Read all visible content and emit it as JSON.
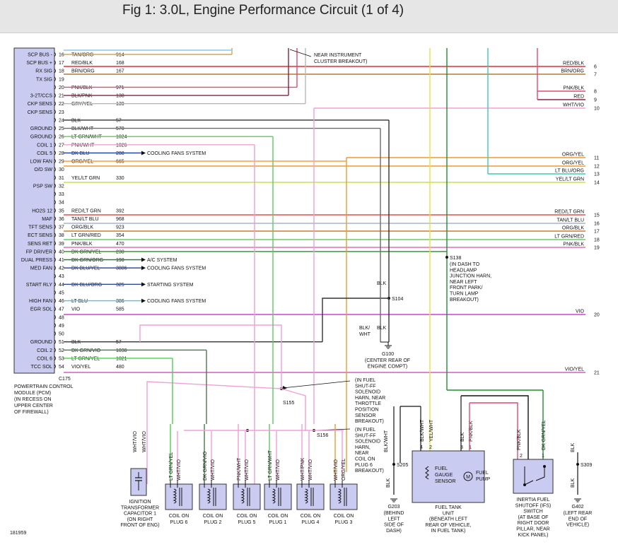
{
  "title": "Fig 1: 3.0L, Engine Performance Circuit (1 of 4)",
  "colors": {
    "pin": "#1a1a1a",
    "box_fill": "#c9cbf0",
    "box_stroke": "#333333",
    "tan_org": "#d2a65a",
    "red_blk": "#e0303a",
    "brn_org": "#b07a3a",
    "pnk_blk": "#e04a74",
    "blk_pnk": "#8a2240",
    "gry_yel": "#b8b8b0",
    "blk": "#333333",
    "blk_wht": "#6a6a6a",
    "lt_grn_wht": "#5ecb5e",
    "pnk_wht": "#f0a0c8",
    "dk_blu": "#1f3f9f",
    "org_yel": "#f09a30",
    "yel_lt_grn": "#c8e050",
    "red_lt_grn": "#e05050",
    "tan_lt_blu": "#a2b8c8",
    "org_blk": "#d07a30",
    "lt_grn_red": "#6acb6a",
    "pnk_blu": "#e070b0",
    "dk_grn_yel": "#3a9a3a",
    "dk_grn_org": "#2e7d32",
    "dk_blu_yel": "#3050a8",
    "dk_blu_org": "#304a9a",
    "lt_blu": "#50c0e0",
    "vio": "#d040d0",
    "dk_grn_vio": "#4a7a4a",
    "vio_yel": "#d060c0",
    "lt_blu_org": "#40c8b8",
    "wht_vio": "#f0a0d8",
    "yel_wht": "#e8e040",
    "lt_grn": "#50d050",
    "dk_grn": "#1f8f2f",
    "tan_lt_blu_short": "#8ac8e8"
  },
  "pcm": {
    "connector": "C175",
    "label": [
      "POWERTRAIN CONTROL",
      "MODULE (PCM)",
      "(IN RECESS ON",
      "UPPER CENTER",
      "OF FIREWALL)"
    ],
    "pins": [
      {
        "name": "SCP BUS -",
        "pin": "16",
        "wire": "TAN/ORG",
        "circuit": "914"
      },
      {
        "name": "SCP BUS +",
        "pin": "17",
        "wire": "RED/BLK",
        "circuit": "168"
      },
      {
        "name": "RX SIG",
        "pin": "18",
        "wire": "BRN/ORG",
        "circuit": "167"
      },
      {
        "name": "TX SIG",
        "pin": "19",
        "wire": "",
        "circuit": ""
      },
      {
        "name": "",
        "pin": "20",
        "wire": "PNK/BLK",
        "circuit": "971"
      },
      {
        "name": "3-2T/CCS",
        "pin": "21",
        "wire": "BLK/PNK",
        "circuit": "138"
      },
      {
        "name": "CKP SENS",
        "pin": "22",
        "wire": "GRY/YEL",
        "circuit": "139"
      },
      {
        "name": "CKP SENS",
        "pin": "23",
        "wire": "",
        "circuit": ""
      },
      {
        "name": "",
        "pin": "24",
        "wire": "BLK",
        "circuit": "57"
      },
      {
        "name": "GROUND",
        "pin": "25",
        "wire": "BLK/WHT",
        "circuit": "570"
      },
      {
        "name": "GROUND",
        "pin": "26",
        "wire": "LT GRN/WHT",
        "circuit": "1024"
      },
      {
        "name": "COIL 1",
        "pin": "27",
        "wire": "PNK/WHT",
        "circuit": "1026"
      },
      {
        "name": "COIL 5",
        "pin": "28",
        "wire": "DK BLU",
        "circuit": "288"
      },
      {
        "name": "LOW FAN",
        "pin": "29",
        "wire": "ORG/YEL",
        "circuit": "665"
      },
      {
        "name": "O/D SW",
        "pin": "30",
        "wire": "",
        "circuit": ""
      },
      {
        "name": "",
        "pin": "31",
        "wire": "YEL/LT GRN",
        "circuit": "330"
      },
      {
        "name": "PSP SW",
        "pin": "32",
        "wire": "",
        "circuit": ""
      },
      {
        "name": "",
        "pin": "33",
        "wire": "",
        "circuit": ""
      },
      {
        "name": "",
        "pin": "34",
        "wire": "",
        "circuit": ""
      },
      {
        "name": "HO2S 12",
        "pin": "35",
        "wire": "RED/LT GRN",
        "circuit": "392"
      },
      {
        "name": "MAF",
        "pin": "36",
        "wire": "TAN/LT BLU",
        "circuit": "968"
      },
      {
        "name": "TFT SENS",
        "pin": "37",
        "wire": "ORG/BLK",
        "circuit": "923"
      },
      {
        "name": "ECT SENS",
        "pin": "38",
        "wire": "LT GRN/RED",
        "circuit": "354"
      },
      {
        "name": "SENS RET",
        "pin": "39",
        "wire": "PNK/BLK",
        "circuit": "470"
      },
      {
        "name": "FP DRIVER",
        "pin": "40",
        "wire": "DK GRN/YEL",
        "circuit": "238"
      },
      {
        "name": "DUAL PRESS",
        "pin": "41",
        "wire": "DK GRN/ORG",
        "circuit": "198"
      },
      {
        "name": "MED FAN",
        "pin": "42",
        "wire": "DK BLU/YEL",
        "circuit": "3886"
      },
      {
        "name": "",
        "pin": "43",
        "wire": "",
        "circuit": ""
      },
      {
        "name": "START RLY",
        "pin": "44",
        "wire": "DK BLU/ORG",
        "circuit": "325"
      },
      {
        "name": "",
        "pin": "45",
        "wire": "",
        "circuit": ""
      },
      {
        "name": "HIGH FAN",
        "pin": "46",
        "wire": "LT BLU",
        "circuit": "386"
      },
      {
        "name": "EGR SOL",
        "pin": "47",
        "wire": "VIO",
        "circuit": "585"
      },
      {
        "name": "",
        "pin": "48",
        "wire": "",
        "circuit": ""
      },
      {
        "name": "",
        "pin": "49",
        "wire": "",
        "circuit": ""
      },
      {
        "name": "",
        "pin": "50",
        "wire": "",
        "circuit": ""
      },
      {
        "name": "GROUND",
        "pin": "51",
        "wire": "BLK",
        "circuit": "57"
      },
      {
        "name": "COIL 2",
        "pin": "52",
        "wire": "DK GRN/VIO",
        "circuit": "1030"
      },
      {
        "name": "COIL 6",
        "pin": "53",
        "wire": "LT GRN/YEL",
        "circuit": "1021"
      },
      {
        "name": "TCC SOL",
        "pin": "54",
        "wire": "VIO/YEL",
        "circuit": "480"
      }
    ]
  },
  "right_wires": [
    {
      "wire": "RED/BLK",
      "num": "6"
    },
    {
      "wire": "BRN/ORG",
      "num": "7"
    },
    {
      "wire": "PNK/BLK",
      "num": "8"
    },
    {
      "wire": "RED",
      "num": "9"
    },
    {
      "wire": "WHT/VIO",
      "num": "10"
    },
    {
      "wire": "ORG/YEL",
      "num": "11"
    },
    {
      "wire": "ORG/YEL",
      "num": "12"
    },
    {
      "wire": "LT BLU/ORG",
      "num": "13"
    },
    {
      "wire": "YEL/LT GRN",
      "num": "14"
    },
    {
      "wire": "RED/LT GRN",
      "num": "15"
    },
    {
      "wire": "TAN/LT BLU",
      "num": "16"
    },
    {
      "wire": "ORG/BLK",
      "num": "17"
    },
    {
      "wire": "LT GRN/RED",
      "num": "18"
    },
    {
      "wire": "PNK/BLK",
      "num": "19"
    },
    {
      "wire": "VIO",
      "num": "20"
    },
    {
      "wire": "VIO/YEL",
      "num": "21"
    }
  ],
  "arrow_labels": {
    "cooling1": "COOLING FANS SYSTEM",
    "ac": "A/C SYSTEM",
    "cooling2": "COOLING FANS SYSTEM",
    "starting": "STARTING SYSTEM",
    "cooling3": "COOLING FANS SYSTEM"
  },
  "notes": {
    "near_cluster": "NEAR INSTRUMENT",
    "near_cluster2": "CLUSTER BREAKOUT)",
    "s138": "S138",
    "s138_desc": [
      "(IN DASH TO",
      "HEADLAMP",
      "JUNCTION HARN,",
      "NEAR LEFT",
      "FRONT PARK/",
      "TURN LAMP",
      "BREAKOUT)"
    ],
    "s104": "S104",
    "blk": "BLK",
    "blk2": "BLK/",
    "wht": "WHT",
    "blk3": "BLK",
    "g100": "G100",
    "g100_desc": [
      "(CENTER REAR OF",
      "ENGINE COMPT)"
    ],
    "s155": "S155",
    "s155_desc": [
      "(IN FUEL",
      "SHUT-FF",
      "SOLENOID",
      "HARN, NEAR",
      "THROTTLE",
      "POSITION",
      "SENSOR",
      "BREAKOUT)"
    ],
    "s156": "S156",
    "s156_desc": [
      "(IN FUEL",
      "SHUT-FF",
      "SOLENOID",
      "HARN,",
      "NEAR",
      "COIL ON",
      "PLUG 6",
      "BREAKOUT)"
    ],
    "figure_id": "181959"
  },
  "coils": [
    {
      "label": [
        "COIL ON",
        "PLUG 6"
      ],
      "w1": "LT GRN/YEL",
      "w2": "WHT/VIO"
    },
    {
      "label": [
        "COIL ON",
        "PLUG 2"
      ],
      "w1": "DK GRN/VIO",
      "w2": "WHT/VIO"
    },
    {
      "label": [
        "COIL ON",
        "PLUG 5"
      ],
      "w1": "PNK/WHT",
      "w2": "WHT/VIO"
    },
    {
      "label": [
        "COIL ON",
        "PLUG 1"
      ],
      "w1": "LT GRN/WHT",
      "w2": "WHT/VIO"
    },
    {
      "label": [
        "COIL ON",
        "PLUG 4"
      ],
      "w1": "WHT/PNK",
      "w2": "WHT/VIO"
    },
    {
      "label": [
        "COIL ON",
        "PLUG 3"
      ],
      "w1": "WHT/VIO",
      "w2": "ORG/YEL"
    }
  ],
  "capacitor": {
    "label": [
      "IGNITION",
      "TRANSFORMER",
      "CAPACITOR 1",
      "(ON RIGHT",
      "FRONT OF ENG)"
    ],
    "w1": "WHT/VIO",
    "w2": "WHT/VIO"
  },
  "fuel_tank": {
    "label": [
      "FUEL TANK",
      "UNIT",
      "(BENEATH LEFT",
      "REAR OF VEHICLE,",
      "IN FUEL TANK)"
    ],
    "gauge": [
      "FUEL",
      "GAUGE",
      "SENSOR"
    ],
    "pump": [
      "FUEL",
      "PUMP"
    ],
    "pins": [
      "4",
      "2",
      "3",
      "1"
    ],
    "wires": [
      "BLK/WHT",
      "YEL/WHT",
      "BLK",
      "PNK/BLK"
    ],
    "blkwht": "BLK/WHT"
  },
  "ifs": {
    "label": [
      "INERTIA FUEL",
      "SHUTOFF (IFS)",
      "SWITCH",
      "(AT BASE OF",
      "RIGHT DOOR",
      "PILLAR, NEAR",
      "KICK PANEL)"
    ],
    "pins": [
      "2",
      "1"
    ],
    "wires": [
      "PNK/BLK",
      "DK GRN/YEL"
    ]
  },
  "s205": "S205",
  "g203": {
    "name": "G203",
    "desc": [
      "(BEHIND",
      "LEFT",
      "SIDE OF",
      "DASH)"
    ],
    "wire": "BLK"
  },
  "s309": "S309",
  "g402": {
    "name": "G402",
    "desc": [
      "(LEFT REAR",
      "END OF",
      "VEHICLE)"
    ],
    "wire": "BLK",
    "wire_top": "BLK"
  }
}
